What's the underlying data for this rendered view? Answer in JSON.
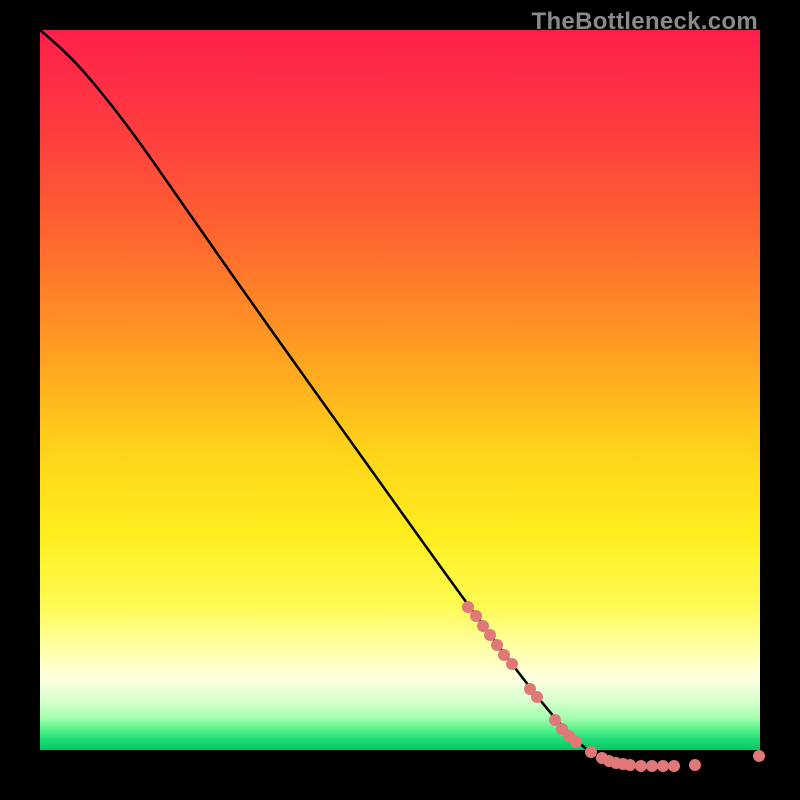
{
  "watermark": "TheBottleneck.com",
  "colors": {
    "dot": "#e07878",
    "curve": "#000000"
  },
  "chart_data": {
    "type": "line",
    "title": "",
    "xlabel": "",
    "ylabel": "",
    "xlim": [
      0,
      100
    ],
    "ylim": [
      0,
      100
    ],
    "gradient_stops": [
      {
        "offset": 0.0,
        "color": "#ff1f4a"
      },
      {
        "offset": 0.15,
        "color": "#ff3f3f"
      },
      {
        "offset": 0.3,
        "color": "#ff6a2e"
      },
      {
        "offset": 0.45,
        "color": "#ffa021"
      },
      {
        "offset": 0.58,
        "color": "#ffd21a"
      },
      {
        "offset": 0.7,
        "color": "#ffee1e"
      },
      {
        "offset": 0.8,
        "color": "#fffb55"
      },
      {
        "offset": 0.86,
        "color": "#ffffa8"
      },
      {
        "offset": 0.9,
        "color": "#ffffe0"
      },
      {
        "offset": 0.93,
        "color": "#d9ffd0"
      },
      {
        "offset": 0.955,
        "color": "#a8ffb0"
      },
      {
        "offset": 0.97,
        "color": "#5ef28a"
      },
      {
        "offset": 0.985,
        "color": "#1fdc78"
      },
      {
        "offset": 1.0,
        "color": "#00c762"
      }
    ],
    "curve": [
      {
        "x": 0.0,
        "y": 100.0
      },
      {
        "x": 3.0,
        "y": 97.5
      },
      {
        "x": 6.0,
        "y": 94.5
      },
      {
        "x": 10.0,
        "y": 89.8
      },
      {
        "x": 14.0,
        "y": 84.6
      },
      {
        "x": 18.0,
        "y": 79.0
      },
      {
        "x": 30.0,
        "y": 62.3
      },
      {
        "x": 45.0,
        "y": 41.9
      },
      {
        "x": 60.0,
        "y": 21.5
      },
      {
        "x": 70.0,
        "y": 8.6
      },
      {
        "x": 75.0,
        "y": 3.4
      },
      {
        "x": 78.0,
        "y": 1.4
      },
      {
        "x": 80.0,
        "y": 0.8
      },
      {
        "x": 85.0,
        "y": 0.6
      },
      {
        "x": 90.0,
        "y": 0.6
      },
      {
        "x": 95.0,
        "y": 0.8
      },
      {
        "x": 98.0,
        "y": 1.2
      },
      {
        "x": 100.0,
        "y": 2.0
      }
    ],
    "series": [
      {
        "name": "highlighted-points",
        "type": "scatter",
        "points": [
          {
            "x": 59.5,
            "y": 22.0
          },
          {
            "x": 60.5,
            "y": 20.8
          },
          {
            "x": 61.5,
            "y": 19.5
          },
          {
            "x": 62.5,
            "y": 18.2
          },
          {
            "x": 63.5,
            "y": 16.9
          },
          {
            "x": 64.5,
            "y": 15.6
          },
          {
            "x": 65.5,
            "y": 14.3
          },
          {
            "x": 68.0,
            "y": 11.0
          },
          {
            "x": 69.0,
            "y": 9.8
          },
          {
            "x": 71.5,
            "y": 6.8
          },
          {
            "x": 72.5,
            "y": 5.6
          },
          {
            "x": 73.5,
            "y": 4.6
          },
          {
            "x": 74.5,
            "y": 3.8
          },
          {
            "x": 76.5,
            "y": 2.4
          },
          {
            "x": 78.0,
            "y": 1.6
          },
          {
            "x": 79.0,
            "y": 1.2
          },
          {
            "x": 80.0,
            "y": 0.9
          },
          {
            "x": 81.0,
            "y": 0.75
          },
          {
            "x": 82.0,
            "y": 0.65
          },
          {
            "x": 83.5,
            "y": 0.6
          },
          {
            "x": 85.0,
            "y": 0.6
          },
          {
            "x": 86.5,
            "y": 0.6
          },
          {
            "x": 88.0,
            "y": 0.6
          },
          {
            "x": 91.0,
            "y": 0.65
          },
          {
            "x": 99.8,
            "y": 1.9
          }
        ]
      }
    ]
  }
}
